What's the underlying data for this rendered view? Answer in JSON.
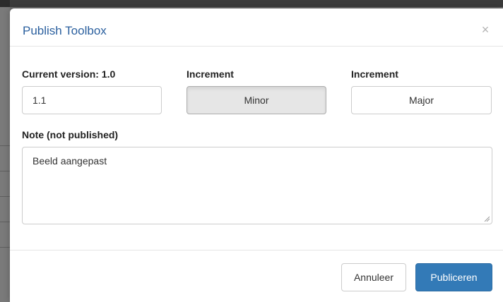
{
  "dialog": {
    "title": "Publish Toolbox",
    "close_icon": "×"
  },
  "version": {
    "current_label": "Current version: 1.0",
    "new_value": "1.1"
  },
  "increment": {
    "minor_label": "Increment",
    "minor_button": "Minor",
    "major_label": "Increment",
    "major_button": "Major",
    "selected": "Minor"
  },
  "note": {
    "label": "Note (not published)",
    "value": "Beeld aangepast"
  },
  "footer": {
    "cancel_label": "Annuleer",
    "publish_label": "Publiceren"
  },
  "colors": {
    "title": "#2a5f9e",
    "primary": "#337ab7",
    "active_choice": "#e6e6e6"
  }
}
